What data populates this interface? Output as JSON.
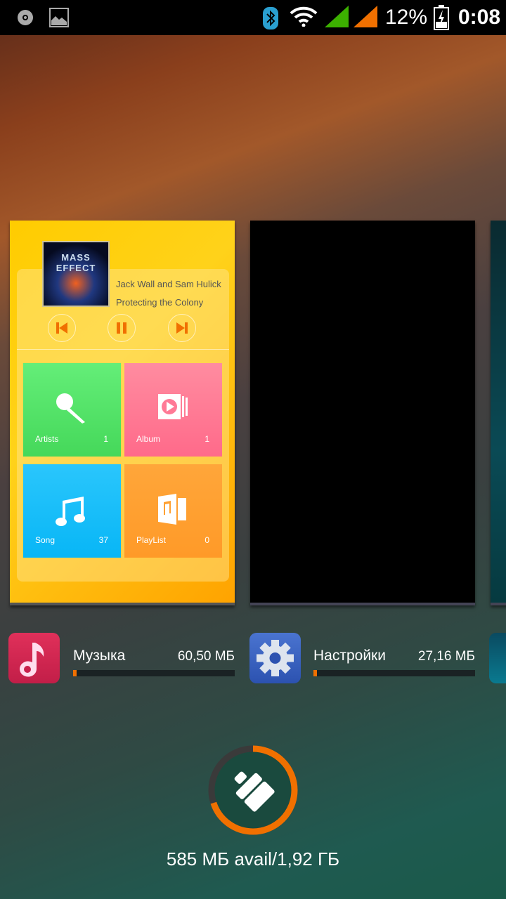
{
  "status_bar": {
    "battery": "12%",
    "time": "0:08",
    "icons": [
      "cd-icon",
      "image-icon",
      "bluetooth-icon",
      "wifi-icon",
      "signal-green-icon",
      "signal-orange-icon",
      "battery-charging-icon"
    ]
  },
  "recent_cards": [
    {
      "app": "Музыка",
      "size": "60,50 МБ",
      "usage_fraction": 0.02,
      "player": {
        "artist": "Jack Wall and Sam Hulick",
        "track": "Protecting the Colony",
        "album_art_text": "MASS EFFECT",
        "tiles": [
          {
            "label": "Artists",
            "count": "1",
            "color": "#55e06a"
          },
          {
            "label": "Album",
            "count": "1",
            "color": "#ff7a96"
          },
          {
            "label": "Song",
            "count": "37",
            "color": "#18c0fa"
          },
          {
            "label": "PlayList",
            "count": "0",
            "color": "#ffa030"
          }
        ]
      }
    },
    {
      "app": "Настройки",
      "size": "27,16 МБ",
      "usage_fraction": 0.02
    }
  ],
  "memory": {
    "text": "585 МБ avail/1,92 ГБ",
    "used_fraction": 0.7,
    "accent": "#f07000"
  }
}
